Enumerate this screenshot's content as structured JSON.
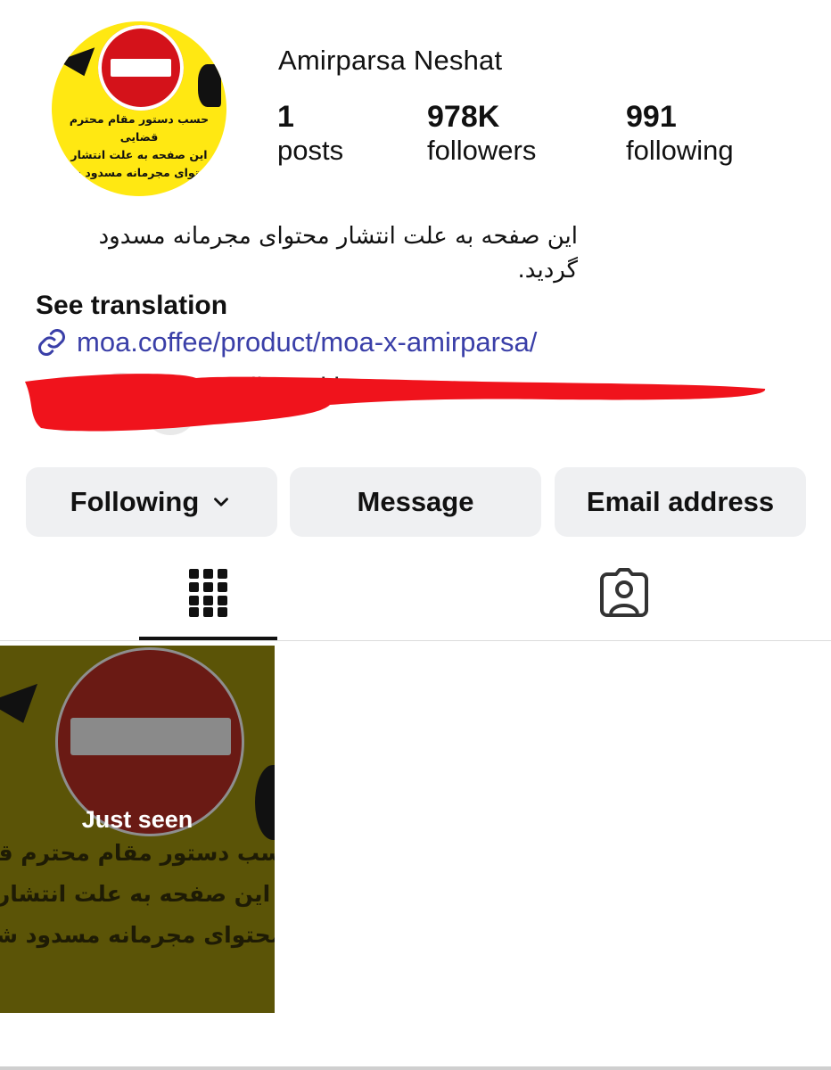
{
  "profile": {
    "name": "Amirparsa Neshat",
    "avatar_text": [
      "حسب دستور مقام محترم قضایی",
      "این صفحه به علت انتشار",
      "محتوای مجرمانه مسدود شد"
    ]
  },
  "stats": [
    {
      "value": "1",
      "label": "posts"
    },
    {
      "value": "978K",
      "label": "followers"
    },
    {
      "value": "991",
      "label": "following"
    }
  ],
  "bio": {
    "line1": "این صفحه به علت انتشار محتوای مجرمانه مسدود",
    "line2": "گردید.",
    "see_translation": "See translation",
    "link": "moa.coffee/product/moa-x-amirparsa/"
  },
  "followed_by": {
    "text": "Followed by"
  },
  "actions": {
    "following": "Following",
    "message": "Message",
    "email": "Email address"
  },
  "tabs": {
    "grid_icon": "grid-icon",
    "tagged_icon": "tagged-person-icon"
  },
  "posts": [
    {
      "overlay": "Just seen",
      "text": [
        "حسب دستور مقام محترم قضا",
        "این صفحه به علت انتشار",
        "محتوای مجرمانه مسدود شد"
      ]
    }
  ],
  "colors": {
    "avatar_bg": "#ffe812",
    "stop_red": "#d4121a",
    "link": "#3a3fa8",
    "button_bg": "#eff0f2",
    "redaction": "#f0131c",
    "post_bg": "#5b5407"
  }
}
